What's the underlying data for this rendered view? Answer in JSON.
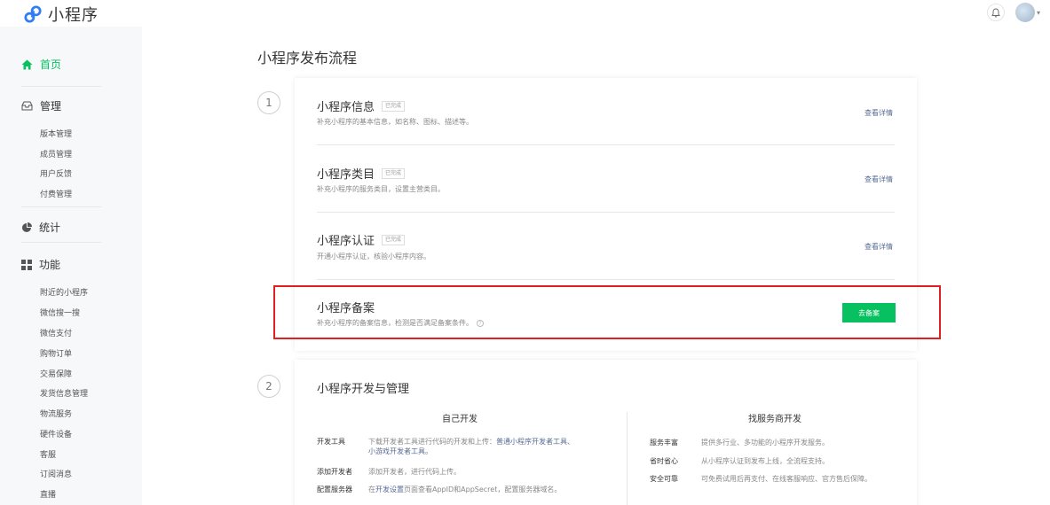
{
  "app": {
    "title": "小程序"
  },
  "sidebar": {
    "home": "首页",
    "groups": [
      {
        "label": "管理",
        "items": [
          "版本管理",
          "成员管理",
          "用户反馈",
          "付费管理"
        ]
      },
      {
        "label": "统计",
        "items": []
      },
      {
        "label": "功能",
        "items": [
          "附近的小程序",
          "微信搜一搜",
          "微信支付",
          "购物订单",
          "交易保障",
          "发货信息管理",
          "物流服务",
          "硬件设备",
          "客服",
          "订阅消息",
          "直播"
        ]
      }
    ]
  },
  "main": {
    "title": "小程序发布流程",
    "step1": {
      "number": "1",
      "rows": [
        {
          "title": "小程序信息",
          "badge": "已完成",
          "desc": "补充小程序的基本信息，如名称、图标、描述等。",
          "action": "查看详情"
        },
        {
          "title": "小程序类目",
          "badge": "已完成",
          "desc": "补充小程序的服务类目，设置主营类目。",
          "action": "查看详情"
        },
        {
          "title": "小程序认证",
          "badge": "已完成",
          "desc": "开通小程序认证，核验小程序内容。",
          "action": "查看详情"
        },
        {
          "title": "小程序备案",
          "badge": "",
          "desc": "补充小程序的备案信息，检测是否满足备案条件。",
          "action": "去备案"
        }
      ]
    },
    "step2": {
      "number": "2",
      "title": "小程序开发与管理",
      "self_dev": {
        "heading": "自己开发",
        "items": [
          {
            "key": "开发工具",
            "val_prefix": "下载开发者工具进行代码的开发和上传：",
            "link1": "普通小程序开发者工具、",
            "link2": "小游戏开发者工具。"
          },
          {
            "key": "添加开发者",
            "val": "添加开发者，进行代码上传。"
          },
          {
            "key": "配置服务器",
            "val_prefix": "在",
            "link1": "开发设置",
            "val_suffix": "页面查看AppID和AppSecret，配置服务器域名。"
          }
        ]
      },
      "provider_dev": {
        "heading": "找服务商开发",
        "items": [
          {
            "key": "服务丰富",
            "val": "提供多行业、多功能的小程序开发服务。"
          },
          {
            "key": "省时省心",
            "val": "从小程序认证到发布上线，全流程支持。"
          },
          {
            "key": "安全可靠",
            "val": "可免费试用后再支付、在线客服响应、官方售后保障。"
          }
        ]
      }
    }
  },
  "colors": {
    "brand": "#07c160",
    "link": "#576b95",
    "highlight": "#e02020"
  }
}
